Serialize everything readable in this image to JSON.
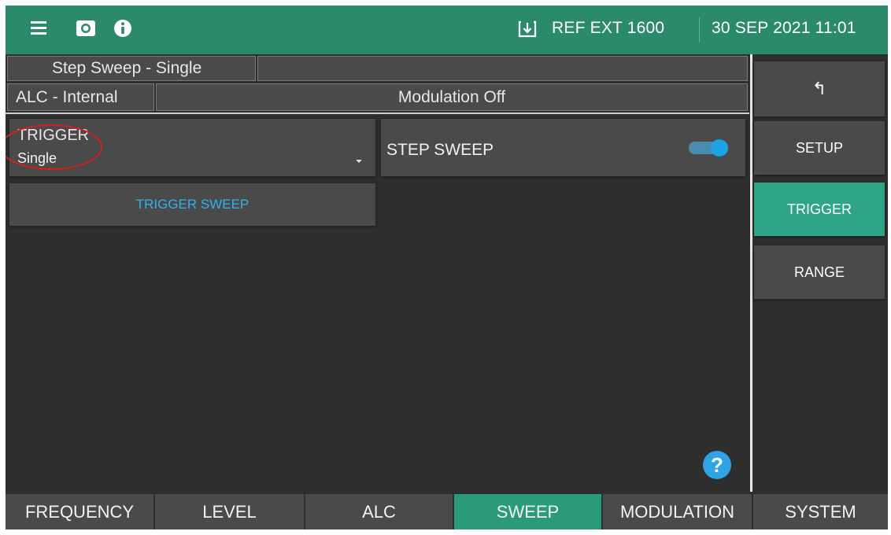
{
  "header": {
    "icons": [
      "menu-icon",
      "camera-icon",
      "info-icon",
      "reference-input-icon"
    ],
    "reference": "REF EXT 1600",
    "datetime": "30 SEP 2021 11:01"
  },
  "status": {
    "sweep_mode": "Step Sweep - Single",
    "alc": "ALC - Internal",
    "modulation": "Modulation Off"
  },
  "trigger_dropdown": {
    "label": "TRIGGER",
    "value": "Single"
  },
  "step_sweep": {
    "label": "STEP SWEEP",
    "enabled": true
  },
  "trigger_sweep_button": "TRIGGER SWEEP",
  "help_label": "?",
  "side_menu": {
    "back_label": "↰",
    "items": [
      {
        "label": "SETUP",
        "active": false
      },
      {
        "label": "TRIGGER",
        "active": true
      },
      {
        "label": "RANGE",
        "active": false
      }
    ]
  },
  "tabs": [
    {
      "label": "FREQUENCY",
      "active": false
    },
    {
      "label": "LEVEL",
      "active": false
    },
    {
      "label": "ALC",
      "active": false
    },
    {
      "label": "SWEEP",
      "active": true
    },
    {
      "label": "MODULATION",
      "active": false
    },
    {
      "label": "SYSTEM",
      "active": false
    }
  ],
  "colors": {
    "header_green": "#2c8a6c",
    "active_green": "#2a9a7b",
    "accent_blue": "#2fb3ee",
    "background": "#2e2e2e"
  }
}
